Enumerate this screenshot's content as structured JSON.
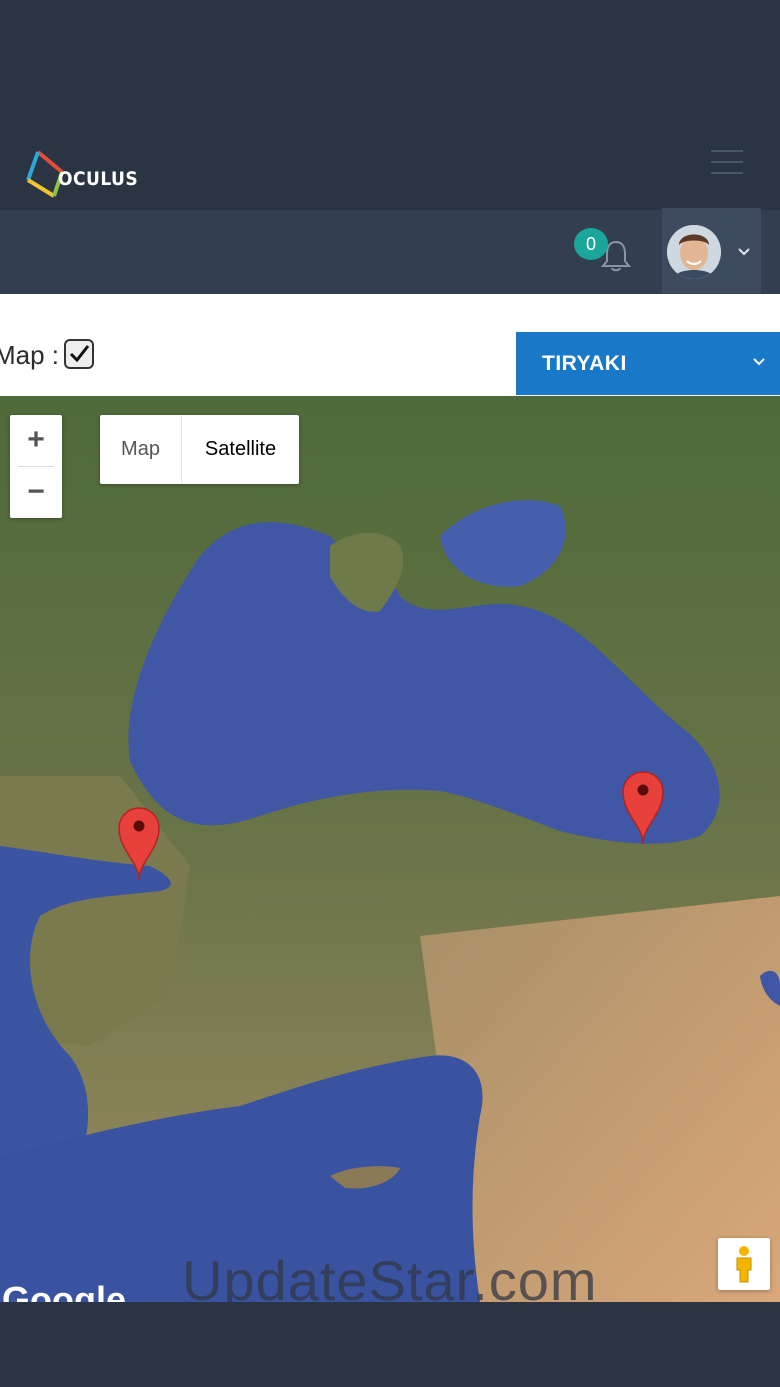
{
  "brand": {
    "logo_text": "OCULUS"
  },
  "header": {
    "menu_icon": "hamburger-icon"
  },
  "nav": {
    "notification_count": "0",
    "bell_icon": "bell-icon",
    "user_menu_icon": "chevron-down-icon"
  },
  "filters": {
    "map_label": "Map :",
    "map_checked": true,
    "company_select": "TIRYAKI"
  },
  "map": {
    "zoom_in": "+",
    "zoom_out": "−",
    "type_map": "Map",
    "type_satellite": "Satellite",
    "active_type": "Satellite",
    "google_text": "Google",
    "markers": [
      "marker-istanbul",
      "marker-trabzon"
    ],
    "marker_color": "#e8403a"
  },
  "watermark": "UpdateStar.com",
  "colors": {
    "header_bg": "#2b3443",
    "navbar_bg": "#333e50",
    "badge": "#1aa79a",
    "select_bg": "#1a78c8"
  }
}
